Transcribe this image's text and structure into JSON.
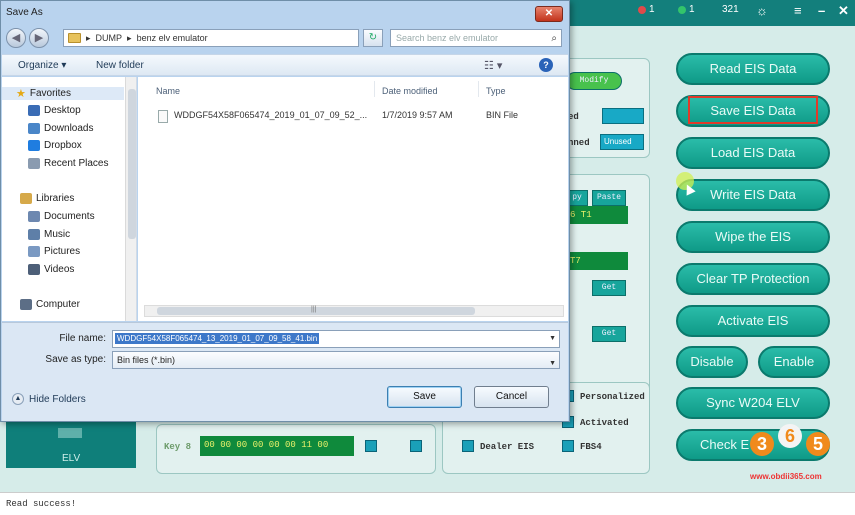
{
  "app": {
    "indicators": [
      {
        "value": "1",
        "color": "#e04a4a"
      },
      {
        "value": "1",
        "color": "#33c46b"
      },
      {
        "value": "321",
        "color": "#dddddd"
      }
    ],
    "buttons": {
      "read": "Read  EIS Data",
      "save": "Save EIS Data",
      "load": "Load EIS Data",
      "write": "Write EIS Data",
      "wipe": "Wipe the EIS",
      "clear_tp": "Clear TP Protection",
      "activate": "Activate EIS",
      "disable": "Disable",
      "enable": "Enable",
      "sync": "Sync W204 ELV",
      "check": "Check E"
    },
    "modify_label": "Modify",
    "fragment_ed": "ed",
    "fragment_nned": "nned",
    "fragment_unused": "Unused",
    "copy_label": "py",
    "paste_label": "Paste",
    "field_t1": "6 T1",
    "field_t7": "T7",
    "get_label_1": "Get",
    "get_label_2": "Get",
    "key8_label": "Key 8",
    "key8_value": "00 00 00 00 00 00 11 00",
    "checks": {
      "personalized": "Personalized",
      "activated": "Activated",
      "dealer_eis": "Dealer EIS",
      "fbs4": "FBS4"
    },
    "elv_label": "ELV",
    "status_text": "Read success!",
    "accent_color": "#0e8a86"
  },
  "dialog": {
    "title": "Save As",
    "breadcrumb": {
      "sep": "▸",
      "part1": "DUMP",
      "part2": "benz elv emulator"
    },
    "search_placeholder": "Search benz elv emulator",
    "organize": "Organize ▾",
    "new_folder": "New folder",
    "nav": {
      "favorites": "Favorites",
      "desktop": "Desktop",
      "downloads": "Downloads",
      "dropbox": "Dropbox",
      "recent": "Recent Places",
      "libraries": "Libraries",
      "documents": "Documents",
      "music": "Music",
      "pictures": "Pictures",
      "videos": "Videos",
      "computer": "Computer"
    },
    "columns": {
      "name": "Name",
      "date": "Date modified",
      "type": "Type"
    },
    "file": {
      "name": "WDDGF54X58F065474_2019_01_07_09_52_...",
      "date": "1/7/2019 9:57 AM",
      "type": "BIN File"
    },
    "file_name_label": "File name:",
    "file_name_value": "WDDGF54X58F065474_13_2019_01_07_09_58_41.bin",
    "save_as_type_label": "Save as type:",
    "save_as_type_value": "Bin files (*.bin)",
    "hide_folders": "Hide Folders",
    "save_button": "Save",
    "cancel_button": "Cancel"
  },
  "watermark": {
    "d1": "3",
    "d2": "6",
    "d3": "5",
    "url": "www.obdii365.com"
  }
}
